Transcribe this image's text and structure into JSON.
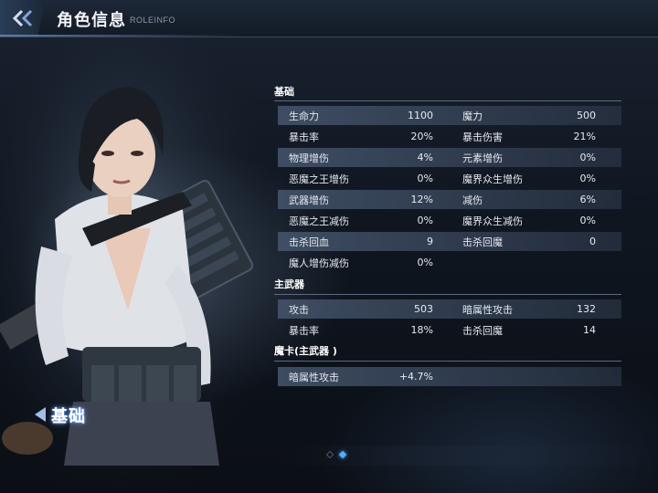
{
  "header": {
    "title": "角色信息",
    "subtitle": "ROLEINFO"
  },
  "character": {
    "tab_label": "基础"
  },
  "sections": {
    "base": {
      "title": "基础",
      "rows": [
        {
          "l_name": "生命力",
          "l_val": "1100",
          "r_name": "魔力",
          "r_val": "500"
        },
        {
          "l_name": "暴击率",
          "l_val": "20%",
          "r_name": "暴击伤害",
          "r_val": "21%"
        },
        {
          "l_name": "物理增伤",
          "l_val": "4%",
          "r_name": "元素增伤",
          "r_val": "0%"
        },
        {
          "l_name": "恶魔之王增伤",
          "l_val": "0%",
          "r_name": "魔界众生增伤",
          "r_val": "0%"
        },
        {
          "l_name": "武器增伤",
          "l_val": "12%",
          "r_name": "减伤",
          "r_val": "6%"
        },
        {
          "l_name": "恶魔之王减伤",
          "l_val": "0%",
          "r_name": "魔界众生减伤",
          "r_val": "0%"
        },
        {
          "l_name": "击杀回血",
          "l_val": "9",
          "r_name": "击杀回魔",
          "r_val": "0"
        },
        {
          "l_name": "魔人增伤减伤",
          "l_val": "0%",
          "r_name": "",
          "r_val": ""
        }
      ]
    },
    "main_weapon": {
      "title": "主武器",
      "rows": [
        {
          "l_name": "攻击",
          "l_val": "503",
          "r_name": "暗属性攻击",
          "r_val": "132"
        },
        {
          "l_name": "暴击率",
          "l_val": "18%",
          "r_name": "击杀回魔",
          "r_val": "14"
        }
      ]
    },
    "magic_card": {
      "title": "魔卡(主武器 )",
      "rows": [
        {
          "l_name": "暗属性攻击",
          "l_val": "+4.7%",
          "r_name": "",
          "r_val": ""
        }
      ]
    }
  },
  "pager": {
    "pages": 2,
    "active": 2
  },
  "colors": {
    "accent": "#4fb0ff",
    "stripe": "#46566e",
    "text": "#e6eaf0"
  }
}
